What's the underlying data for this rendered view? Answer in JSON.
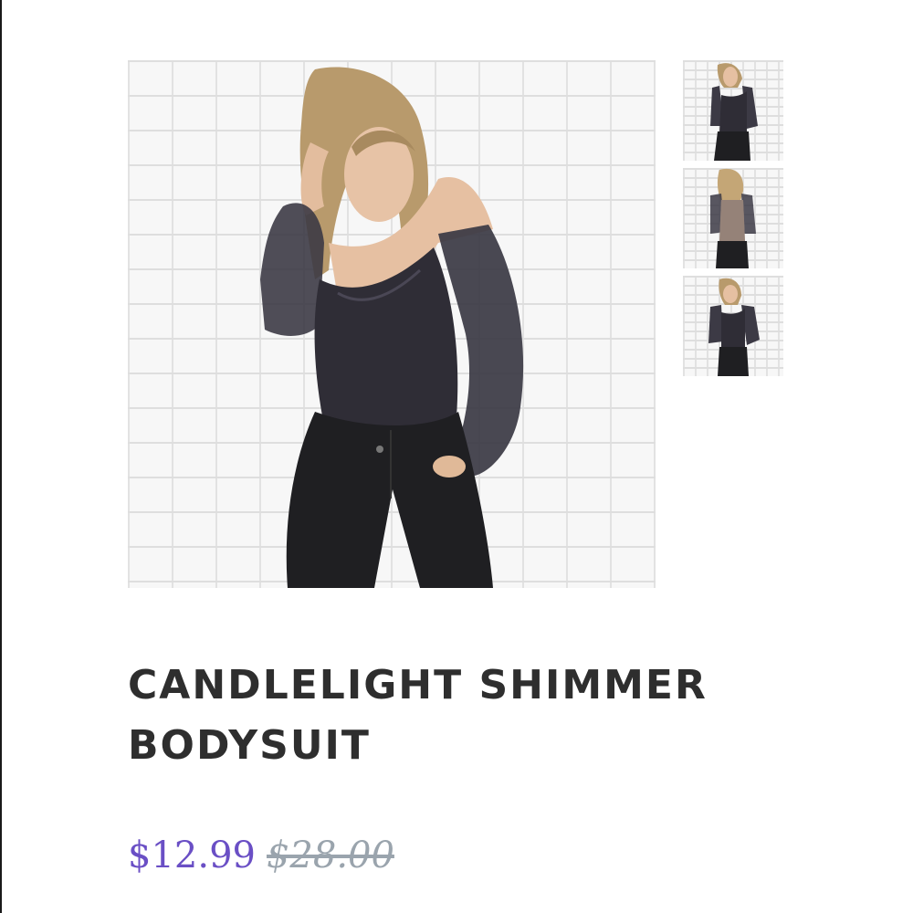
{
  "product": {
    "title": "CANDLELIGHT SHIMMER BODYSUIT",
    "sale_price": "$12.99",
    "original_price": "$28.00"
  },
  "gallery": {
    "thumbnail_count": 3
  },
  "colors": {
    "sale_price": "#6a4fc5",
    "original_price": "#9aa4ad",
    "title": "#2e2e2e"
  },
  "icons": [
    "product-photo",
    "thumbnail-photo"
  ]
}
